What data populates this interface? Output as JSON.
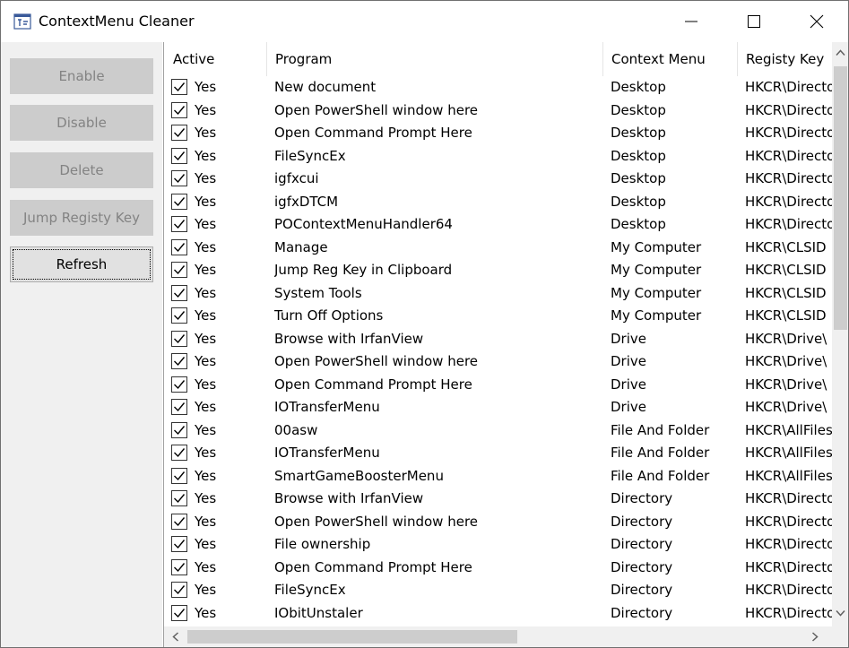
{
  "window": {
    "title": "ContextMenu Cleaner"
  },
  "titlebar_icons": {
    "app": "app-icon",
    "minimize": "minimize-icon",
    "maximize": "maximize-icon",
    "close": "close-icon"
  },
  "sidebar": {
    "buttons": [
      {
        "label": "Enable",
        "enabled": false
      },
      {
        "label": "Disable",
        "enabled": false
      },
      {
        "label": "Delete",
        "enabled": false
      },
      {
        "label": "Jump Registy Key",
        "enabled": false
      },
      {
        "label": "Refresh",
        "enabled": true
      }
    ]
  },
  "table": {
    "columns": [
      "Active",
      "Program",
      "Context Menu",
      "Registy Key"
    ],
    "rows": [
      {
        "checked": true,
        "active": "Yes",
        "program": "New document",
        "menu": "Desktop",
        "key": "HKCR\\Directo"
      },
      {
        "checked": true,
        "active": "Yes",
        "program": "Open PowerShell window here",
        "menu": "Desktop",
        "key": "HKCR\\Directo"
      },
      {
        "checked": true,
        "active": "Yes",
        "program": "Open Command Prompt Here",
        "menu": "Desktop",
        "key": "HKCR\\Directo"
      },
      {
        "checked": true,
        "active": "Yes",
        "program": " FileSyncEx",
        "menu": "Desktop",
        "key": "HKCR\\Directo"
      },
      {
        "checked": true,
        "active": "Yes",
        "program": "igfxcui",
        "menu": "Desktop",
        "key": "HKCR\\Directo"
      },
      {
        "checked": true,
        "active": "Yes",
        "program": "igfxDTCM",
        "menu": "Desktop",
        "key": "HKCR\\Directo"
      },
      {
        "checked": true,
        "active": "Yes",
        "program": "POContextMenuHandler64",
        "menu": "Desktop",
        "key": "HKCR\\Directo"
      },
      {
        "checked": true,
        "active": "Yes",
        "program": "Manage",
        "menu": "My Computer",
        "key": "HKCR\\CLSID"
      },
      {
        "checked": true,
        "active": "Yes",
        "program": "Jump Reg Key in Clipboard",
        "menu": "My Computer",
        "key": "HKCR\\CLSID"
      },
      {
        "checked": true,
        "active": "Yes",
        "program": "System Tools",
        "menu": "My Computer",
        "key": "HKCR\\CLSID"
      },
      {
        "checked": true,
        "active": "Yes",
        "program": "Turn Off Options",
        "menu": "My Computer",
        "key": "HKCR\\CLSID"
      },
      {
        "checked": true,
        "active": "Yes",
        "program": "Browse with IrfanView",
        "menu": "Drive",
        "key": "HKCR\\Drive\\"
      },
      {
        "checked": true,
        "active": "Yes",
        "program": "Open PowerShell window here",
        "menu": "Drive",
        "key": "HKCR\\Drive\\"
      },
      {
        "checked": true,
        "active": "Yes",
        "program": "Open Command Prompt Here",
        "menu": "Drive",
        "key": "HKCR\\Drive\\"
      },
      {
        "checked": true,
        "active": "Yes",
        "program": "IOTransferMenu",
        "menu": "Drive",
        "key": "HKCR\\Drive\\"
      },
      {
        "checked": true,
        "active": "Yes",
        "program": "00asw",
        "menu": "File And Folder",
        "key": "HKCR\\AllFiles"
      },
      {
        "checked": true,
        "active": "Yes",
        "program": "IOTransferMenu",
        "menu": "File And Folder",
        "key": "HKCR\\AllFiles"
      },
      {
        "checked": true,
        "active": "Yes",
        "program": "SmartGameBoosterMenu",
        "menu": "File And Folder",
        "key": "HKCR\\AllFiles"
      },
      {
        "checked": true,
        "active": "Yes",
        "program": "Browse with IrfanView",
        "menu": "Directory",
        "key": "HKCR\\Directo"
      },
      {
        "checked": true,
        "active": "Yes",
        "program": "Open PowerShell window here",
        "menu": "Directory",
        "key": "HKCR\\Directo"
      },
      {
        "checked": true,
        "active": "Yes",
        "program": "File ownership",
        "menu": "Directory",
        "key": "HKCR\\Directo"
      },
      {
        "checked": true,
        "active": "Yes",
        "program": "Open Command Prompt Here",
        "menu": "Directory",
        "key": "HKCR\\Directo"
      },
      {
        "checked": true,
        "active": "Yes",
        "program": " FileSyncEx",
        "menu": "Directory",
        "key": "HKCR\\Directo"
      },
      {
        "checked": true,
        "active": "Yes",
        "program": "IObitUnstaler",
        "menu": "Directory",
        "key": "HKCR\\Directo"
      }
    ]
  },
  "scrollbars": {
    "vertical": "scrollbar-vertical",
    "horizontal": "scrollbar-horizontal"
  },
  "colors": {
    "sidebar_bg": "#f0f0f0",
    "disabled_button_bg": "#cccccc",
    "disabled_text": "#838383",
    "scroll_thumb": "#cdcdcd"
  }
}
